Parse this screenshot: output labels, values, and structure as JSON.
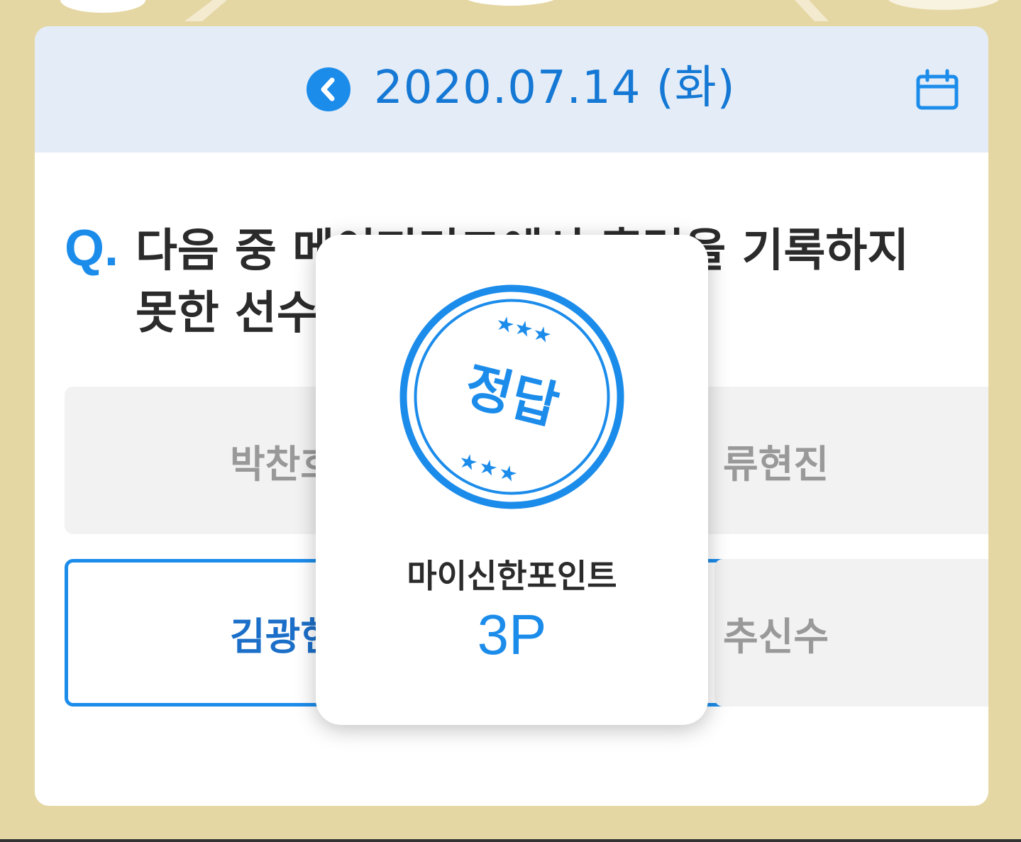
{
  "header": {
    "date": "2020.07.14 (화)"
  },
  "question": {
    "marker": "Q.",
    "text": "다음 중 메이저리그에서 홈런을 기록하지 못한 선수"
  },
  "options": [
    {
      "label": "박찬호"
    },
    {
      "label": "류현진"
    },
    {
      "label": "김광현",
      "selected": true
    },
    {
      "label": "추신수"
    }
  ],
  "result_popup": {
    "stamp_text": "정답",
    "reward_label": "마이신한포인트",
    "reward_value": "3P"
  },
  "colors": {
    "accent": "#1c8ceb",
    "background": "#e5d7a3",
    "header_bg": "#e3ecf7"
  },
  "icons": {
    "prev": "chevron-left-icon",
    "calendar": "calendar-icon"
  }
}
